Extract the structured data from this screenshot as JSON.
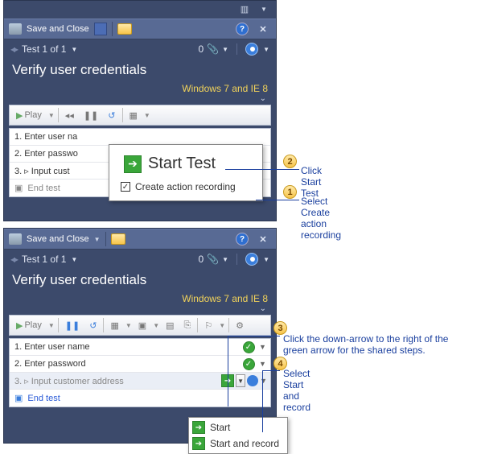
{
  "header": {
    "save_close": "Save and Close"
  },
  "nav": {
    "label": "Test 1 of 1",
    "count": "0"
  },
  "title": "Verify user credentials",
  "config": "Windows 7 and IE 8",
  "toolbar": {
    "play": "Play"
  },
  "panel1": {
    "steps": {
      "s1": "1. Enter user na",
      "s2": "2. Enter passwo",
      "s3": "3. ▹ Input cust",
      "end": "End test"
    },
    "popup": {
      "start_label": "Start Test",
      "checkbox_label": "Create action recording"
    }
  },
  "panel2": {
    "steps": {
      "s1": "1. Enter user name",
      "s2": "2. Enter password",
      "s3": "3. ▹   Input customer address",
      "end": "End test"
    },
    "menu": {
      "start": "Start",
      "start_record": "Start and record"
    }
  },
  "callouts": {
    "c1": {
      "num": "1",
      "text": "Select Create action recording"
    },
    "c2": {
      "num": "2",
      "text": "Click Start Test"
    },
    "c3": {
      "num": "3",
      "text": "Click the down-arrow to the right of the green arrow for the shared steps."
    },
    "c4": {
      "num": "4",
      "text": "Select Start and record"
    }
  }
}
